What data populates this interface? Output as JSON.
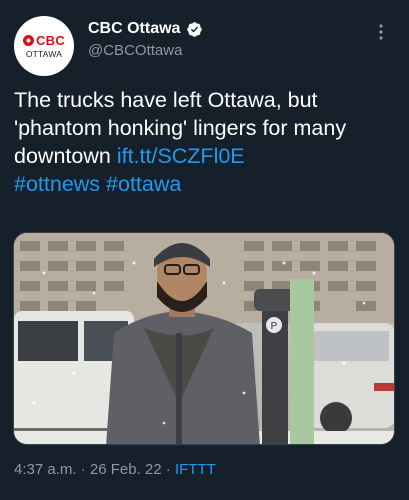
{
  "account": {
    "display_name": "CBC Ottawa",
    "handle": "@CBCOttawa",
    "avatar_logo": "CBC",
    "avatar_sub": "OTTAWA",
    "verified": true
  },
  "tweet": {
    "text": "The trucks have left Ottawa, but 'phantom honking' lingers for many downtown",
    "link": "ift.tt/SCZFl0E",
    "hashtags": [
      "#ottnews",
      "#ottawa"
    ]
  },
  "meta": {
    "time": "4:37 a.m.",
    "separator": "·",
    "date": "26 Feb. 22",
    "source": "IFTTT"
  },
  "icons": {
    "more": "more-options-icon",
    "verified": "verified-badge-icon"
  },
  "colors": {
    "background": "#15202b",
    "link": "#1d9bf0",
    "secondary_text": "#8b98a5",
    "brand_red": "#d4141c"
  }
}
